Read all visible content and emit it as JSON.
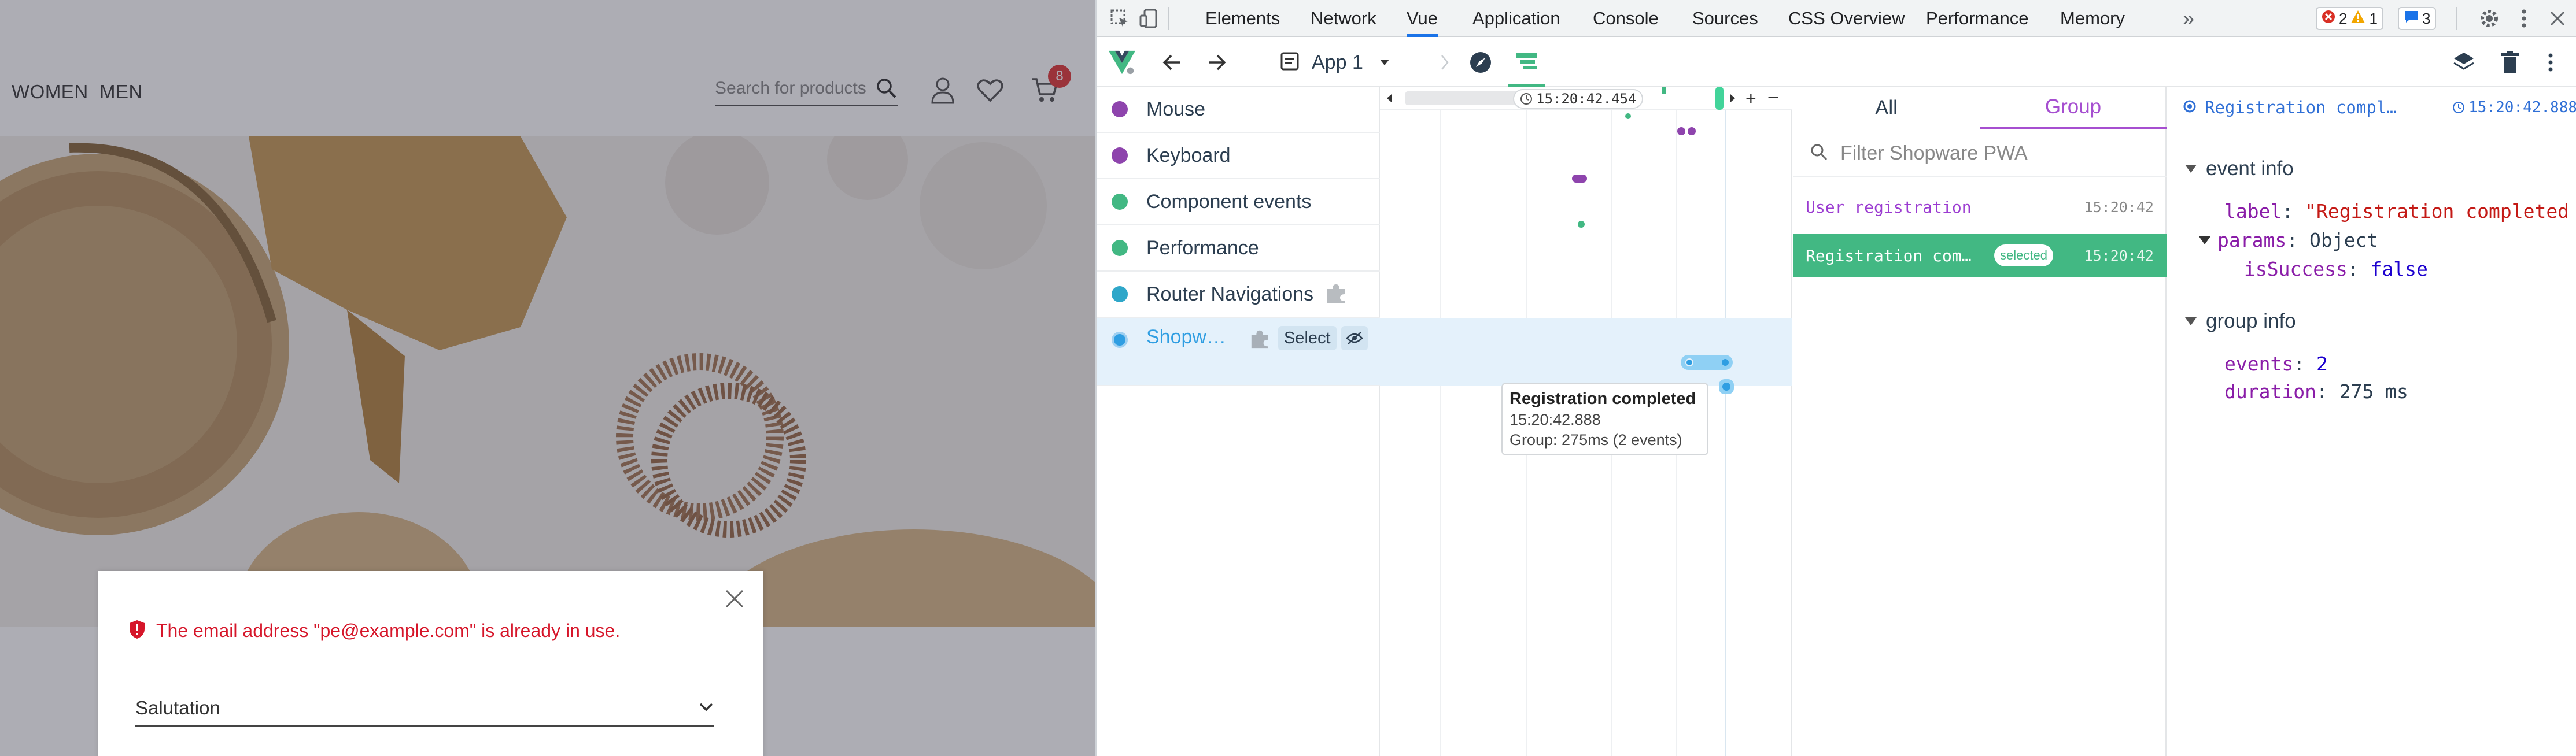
{
  "shop": {
    "nav": {
      "women": "WOMEN",
      "men": "MEN"
    },
    "search": {
      "placeholder": "Search for products"
    },
    "cart_count": "8",
    "modal": {
      "error_text": "The email address \"pe@example.com\" is already in use.",
      "salutation_label": "Salutation"
    }
  },
  "devtools": {
    "tabs": [
      "Elements",
      "Network",
      "Vue",
      "Application",
      "Console",
      "Sources",
      "CSS Overview",
      "Performance",
      "Memory"
    ],
    "active_tab": "Vue",
    "more_tabs": "»",
    "badges": {
      "errors": "2",
      "warnings": "1",
      "messages": "3"
    },
    "vue_toolbar": {
      "app_label": "App 1"
    },
    "layers": [
      {
        "label": "Mouse",
        "color": "#8e44ad"
      },
      {
        "label": "Keyboard",
        "color": "#8e44ad"
      },
      {
        "label": "Component events",
        "color": "#42b883"
      },
      {
        "label": "Performance",
        "color": "#42b883"
      },
      {
        "label": "Router Navigations",
        "color": "#2fa7c9"
      },
      {
        "label": "Shopw…",
        "color": "#2f9ee2"
      }
    ],
    "layer_actions": {
      "select": "Select"
    },
    "timeline": {
      "cursor_time": "15:20:42.454",
      "tooltip": {
        "title": "Registration completed",
        "time": "15:20:42.888",
        "group": "Group: 275ms (2 events)"
      }
    },
    "events": {
      "tabs": {
        "all": "All",
        "group": "Group"
      },
      "active_tab": "Group",
      "filter_placeholder": "Filter Shopware PWA",
      "rows": [
        {
          "name": "User registration",
          "time": "15:20:42"
        },
        {
          "name": "Registration com…",
          "time": "15:20:42",
          "tag": "selected"
        }
      ]
    },
    "inspector": {
      "title": "Registration compl…",
      "time": "15:20:42.888",
      "event_info": {
        "heading": "event info",
        "label_key": "label",
        "label_value": "\"Registration completed",
        "params_key": "params",
        "params_value": "Object",
        "isSuccess_key": "isSuccess",
        "isSuccess_value": "false"
      },
      "group_info": {
        "heading": "group info",
        "events_key": "events",
        "events_value": "2",
        "duration_key": "duration",
        "duration_value": "275 ms"
      }
    }
  }
}
